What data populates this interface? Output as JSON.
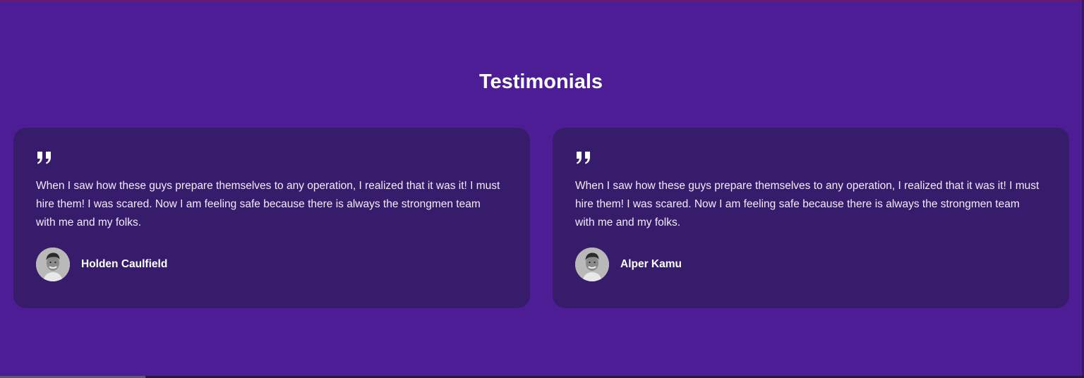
{
  "section": {
    "title": "Testimonials"
  },
  "testimonials": [
    {
      "quote_icon": "quote-icon",
      "text": "When I saw how these guys prepare themselves to any operation, I realized that it was it! I must hire them! I was scared. Now I am feeling safe because there is always the strongmen team with me and my folks.",
      "author": "Holden Caulfield",
      "avatar": "avatar-photo"
    },
    {
      "quote_icon": "quote-icon",
      "text": "When I saw how these guys prepare themselves to any operation, I realized that it was it! I must hire them! I was scared. Now I am feeling safe because there is always the strongmen team with me and my folks.",
      "author": "Alper Kamu",
      "avatar": "avatar-photo"
    }
  ],
  "colors": {
    "background": "#4c1d95",
    "card": "#371c6b",
    "text": "#ffffff"
  }
}
